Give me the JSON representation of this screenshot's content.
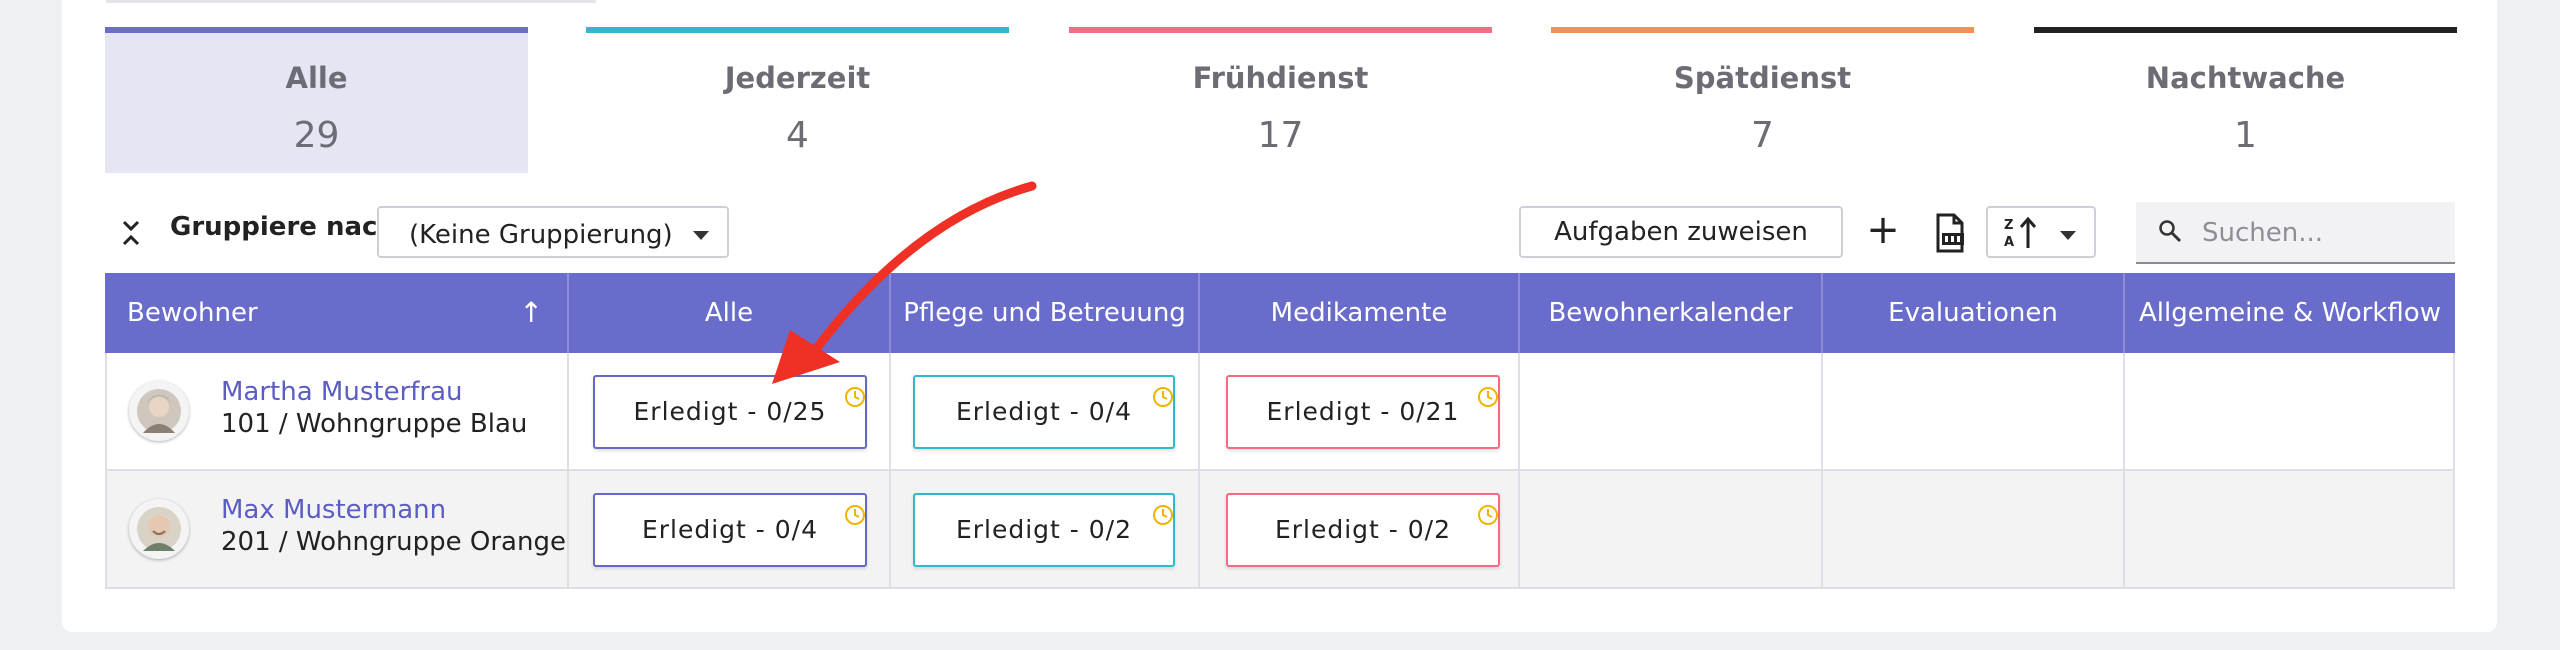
{
  "tabs": [
    {
      "label": "Alle",
      "count": "29",
      "color": "#6c6dc9",
      "active": true
    },
    {
      "label": "Jederzeit",
      "count": "4",
      "color": "#35b6cf",
      "active": false
    },
    {
      "label": "Frühdienst",
      "count": "17",
      "color": "#ef6f86",
      "active": false
    },
    {
      "label": "Spätdienst",
      "count": "7",
      "color": "#f49150",
      "active": false
    },
    {
      "label": "Nachtwache",
      "count": "1",
      "color": "#222222",
      "active": false
    }
  ],
  "toolbar": {
    "group_label": "Gruppiere nach:",
    "group_value": "(Keine Gruppierung)",
    "assign_label": "Aufgaben zuweisen",
    "plus_label": "+",
    "search_placeholder": "Suchen..."
  },
  "table": {
    "headers": [
      "Bewohner",
      "Alle",
      "Pflege und Betreuung",
      "Medikamente",
      "Bewohnerkalender",
      "Evaluationen",
      "Allgemeine & Workflow"
    ],
    "sort_arrow": "↑",
    "rows": [
      {
        "name": "Martha Musterfrau",
        "unit": "101 / Wohngruppe Blau",
        "chips": [
          "Erledigt - 0/25",
          "Erledigt - 0/4",
          "Erledigt - 0/21"
        ]
      },
      {
        "name": "Max Mustermann",
        "unit": "201 / Wohngruppe Orange",
        "chips": [
          "Erledigt - 0/4",
          "Erledigt - 0/2",
          "Erledigt - 0/2"
        ]
      }
    ]
  },
  "colors": {
    "header": "#6a6ccb",
    "accent": "#5b5dc2",
    "annotation_arrow": "#ee3124",
    "clock": "#f0b400"
  }
}
